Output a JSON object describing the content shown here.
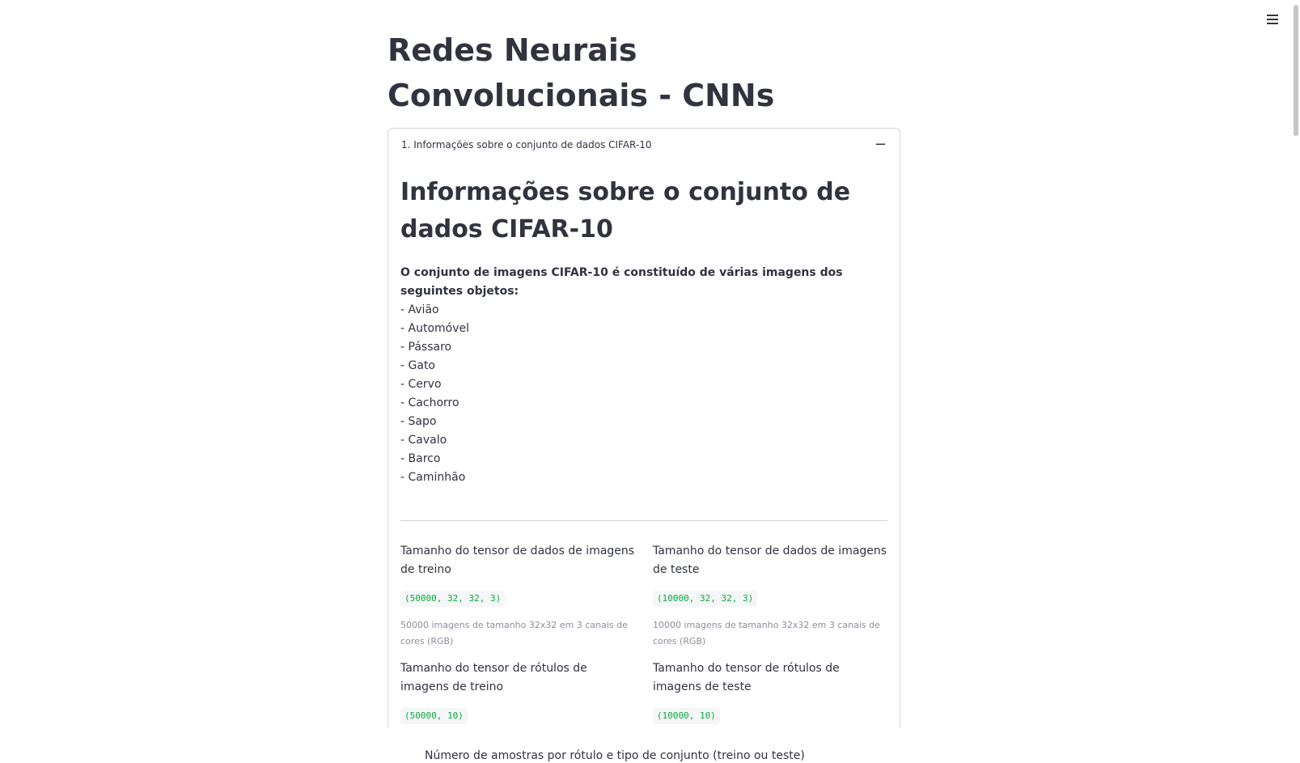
{
  "page": {
    "title": "Redes Neurais Convolucionais - CNNs"
  },
  "expander": {
    "header": "1. Informações sobre o conjunto de dados CIFAR-10",
    "collapse_symbol": "−",
    "section_title": "Informações sobre o conjunto de dados CIFAR-10",
    "intro": "O conjunto de imagens CIFAR-10 é constituído de várias imagens dos seguintes objetos:",
    "objects": [
      "Avião",
      "Automóvel",
      "Pássaro",
      "Gato",
      "Cervo",
      "Cachorro",
      "Sapo",
      "Cavalo",
      "Barco",
      "Caminhão"
    ],
    "metrics": {
      "train_data": {
        "label": "Tamanho do tensor de dados de imagens de treino",
        "value": "(50000, 32, 32, 3)",
        "caption": "50000 imagens de tamanho 32x32 em 3 canais de cores (RGB)"
      },
      "test_data": {
        "label": "Tamanho do tensor de dados de imagens de teste",
        "value": "(10000, 32, 32, 3)",
        "caption": "10000 imagens de tamanho 32x32 em 3 canais de cores (RGB)"
      },
      "train_labels": {
        "label": "Tamanho do tensor de rótulos de imagens de treino",
        "value": "(50000, 10)"
      },
      "test_labels": {
        "label": "Tamanho do tensor de rótulos de imagens de teste",
        "value": "(10000, 10)"
      }
    }
  },
  "chart": {
    "label": "Número de amostras por rótulo e tipo de conjunto (treino ou teste)"
  },
  "icons": {
    "menu": "hamburger-menu-icon"
  },
  "colors": {
    "metric_value": "#09ab3b",
    "caption": "#8b8f99",
    "text": "#31333f"
  }
}
